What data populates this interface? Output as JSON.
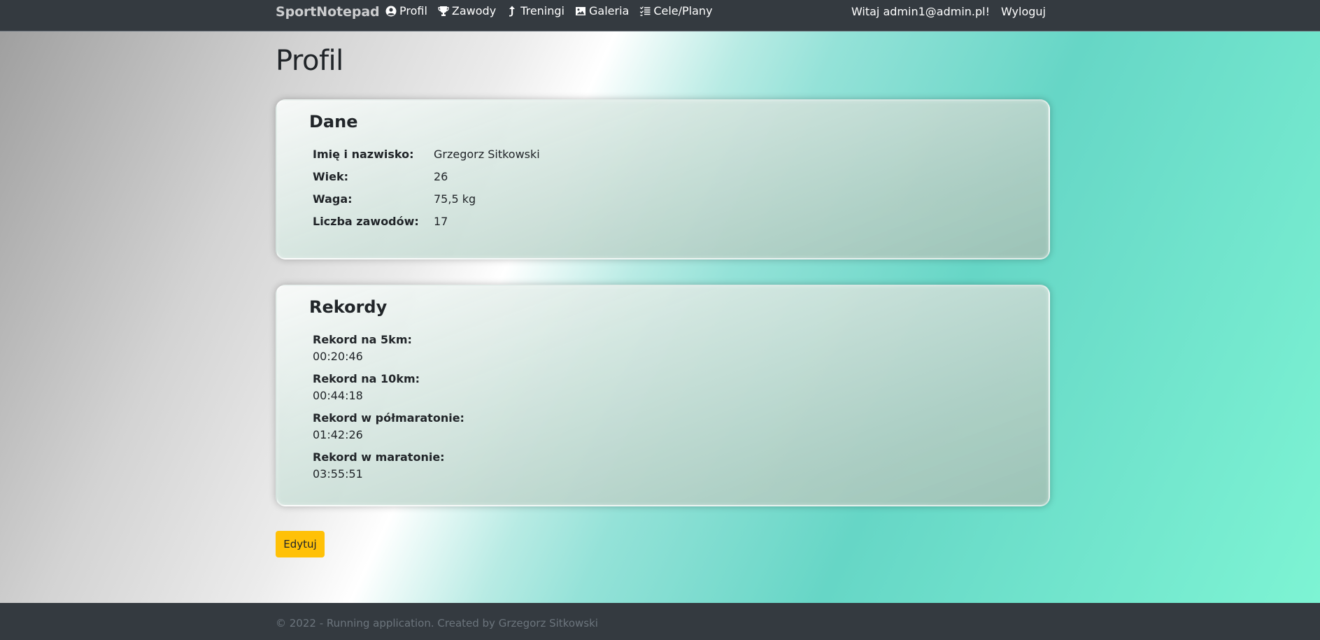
{
  "navbar": {
    "brand": "SportNotepad",
    "items": [
      {
        "label": "Profil",
        "icon": "user-circle-icon"
      },
      {
        "label": "Zawody",
        "icon": "trophy-icon"
      },
      {
        "label": "Treningi",
        "icon": "arrow-up-icon"
      },
      {
        "label": "Galeria",
        "icon": "image-icon"
      },
      {
        "label": "Cele/Plany",
        "icon": "checklist-icon"
      }
    ],
    "greeting": "Witaj admin1@admin.pl!",
    "logout": "Wyloguj"
  },
  "page": {
    "title": "Profil"
  },
  "dane": {
    "title": "Dane",
    "rows": [
      {
        "label": "Imię i nazwisko:",
        "value": "Grzegorz Sitkowski"
      },
      {
        "label": "Wiek:",
        "value": "26"
      },
      {
        "label": "Waga:",
        "value": "75,5 kg"
      },
      {
        "label": "Liczba zawodów:",
        "value": "17"
      }
    ]
  },
  "rekordy": {
    "title": "Rekordy",
    "records": [
      {
        "label": "Rekord na 5km:",
        "value": "00:20:46"
      },
      {
        "label": "Rekord na 10km:",
        "value": "00:44:18"
      },
      {
        "label": "Rekord w półmaratonie:",
        "value": "01:42:26"
      },
      {
        "label": "Rekord w maratonie:",
        "value": "03:55:51"
      }
    ]
  },
  "actions": {
    "edit_label": "Edytuj"
  },
  "footer": {
    "text": "© 2022 - Running application. Created by Grzegorz Sitkowski"
  },
  "colors": {
    "navbar_bg": "#343a40",
    "edit_button": "#ffc107",
    "footer_text": "#6c757d"
  }
}
